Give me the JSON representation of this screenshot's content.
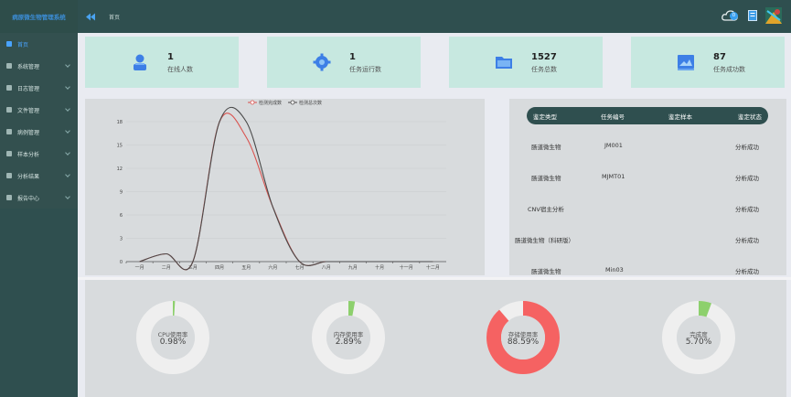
{
  "app": {
    "title": "病原微生物管理系统"
  },
  "sidebar": {
    "items": [
      {
        "label": "首页",
        "active": true,
        "icon": "home-icon"
      },
      {
        "label": "系统管理",
        "icon": "settings-icon"
      },
      {
        "label": "日志管理",
        "icon": "log-icon"
      },
      {
        "label": "文件管理",
        "icon": "file-icon"
      },
      {
        "label": "病例管理",
        "icon": "case-icon"
      },
      {
        "label": "样本分析",
        "icon": "sample-icon"
      },
      {
        "label": "分析结果",
        "icon": "result-icon"
      },
      {
        "label": "报告中心",
        "icon": "report-icon"
      }
    ]
  },
  "header": {
    "breadcrumb": "首页",
    "badge": "0"
  },
  "stats": [
    {
      "value": "1",
      "label": "在线人数",
      "icon": "user-icon"
    },
    {
      "value": "1",
      "label": "任务运行数",
      "icon": "gear-icon"
    },
    {
      "value": "1527",
      "label": "任务总数",
      "icon": "folder-icon"
    },
    {
      "value": "87",
      "label": "任务成功数",
      "icon": "image-icon"
    }
  ],
  "chart_data": {
    "type": "line",
    "categories": [
      "一月",
      "二月",
      "三月",
      "四月",
      "五月",
      "六月",
      "七月",
      "八月",
      "九月",
      "十月",
      "十一月",
      "十二月"
    ],
    "series": [
      {
        "name": "检测完成数",
        "color": "#d9534f",
        "values": [
          0,
          1,
          0,
          18,
          16,
          7,
          0,
          0,
          0,
          0,
          0,
          0
        ]
      },
      {
        "name": "检测总次数",
        "color": "#4a4a4a",
        "values": [
          0,
          1,
          0,
          18,
          18,
          7,
          0,
          0,
          0,
          0,
          0,
          0
        ]
      }
    ],
    "yticks": [
      0,
      3,
      6,
      9,
      12,
      15,
      18
    ],
    "ylim": [
      0,
      18
    ],
    "legend": "top-center"
  },
  "table": {
    "headers": [
      "鉴定类型",
      "任务编号",
      "鉴定样本",
      "鉴定状态"
    ],
    "rows": [
      {
        "type": "肠道微生物",
        "id": "JM001",
        "sample": "",
        "status": "分析成功"
      },
      {
        "type": "肠道微生物",
        "id": "MJMT01",
        "sample": "",
        "status": "分析成功"
      },
      {
        "type": "CNV宿主分析",
        "id": "",
        "sample": "",
        "status": "分析成功"
      },
      {
        "type": "肠道微生物（科研版）",
        "id": "",
        "sample": "",
        "status": "分析成功"
      },
      {
        "type": "肠道微生物",
        "id": "Min03",
        "sample": "",
        "status": "分析成功"
      }
    ]
  },
  "gauges": [
    {
      "label": "CPU使用率",
      "value_text": "0.98%",
      "value": 0.98,
      "color": "#8dd06d"
    },
    {
      "label": "内存使用率",
      "value_text": "2.89%",
      "value": 2.89,
      "color": "#8dd06d"
    },
    {
      "label": "存储使用率",
      "value_text": "88.59%",
      "value": 88.59,
      "color": "#f56262"
    },
    {
      "label": "完成度",
      "value_text": "5.70%",
      "value": 5.7,
      "color": "#8dd06d"
    }
  ]
}
